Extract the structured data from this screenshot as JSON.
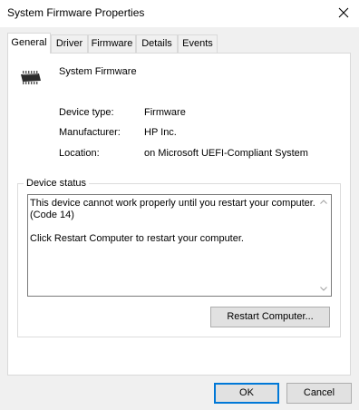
{
  "window": {
    "title": "System Firmware Properties"
  },
  "tabs": [
    {
      "label": "General",
      "active": true
    },
    {
      "label": "Driver"
    },
    {
      "label": "Firmware"
    },
    {
      "label": "Details"
    },
    {
      "label": "Events"
    }
  ],
  "device": {
    "name": "System Firmware",
    "icon": "chip-icon"
  },
  "properties": {
    "type_label": "Device type:",
    "type_value": "Firmware",
    "manufacturer_label": "Manufacturer:",
    "manufacturer_value": "HP Inc.",
    "location_label": "Location:",
    "location_value": "on Microsoft UEFI-Compliant System"
  },
  "status": {
    "group_label": "Device status",
    "text": "This device cannot work properly until you restart your computer.\n(Code 14)\n\nClick Restart Computer to restart your computer.",
    "restart_button": "Restart Computer..."
  },
  "footer": {
    "ok": "OK",
    "cancel": "Cancel"
  },
  "colors": {
    "accent": "#0078d7",
    "dialog_bg": "#f0f0f0",
    "panel_bg": "#ffffff"
  }
}
